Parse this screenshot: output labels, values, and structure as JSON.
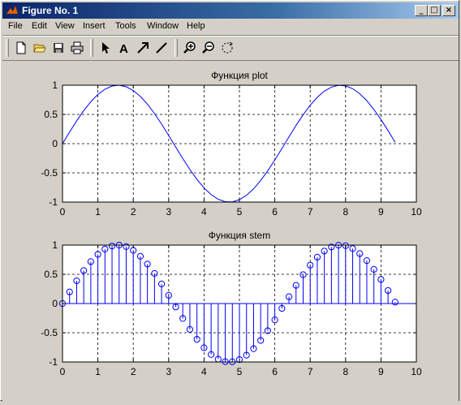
{
  "window": {
    "title": "Figure No. 1"
  },
  "window_buttons": {
    "minimize": "_",
    "maximize": "□",
    "close": "×"
  },
  "menu": [
    "File",
    "Edit",
    "View",
    "Insert",
    "Tools",
    "Window",
    "Help"
  ],
  "toolbar": {
    "icons": [
      "new-file-icon",
      "open-folder-icon",
      "save-icon",
      "print-icon",
      "pointer-arrow-icon",
      "insert-text-icon",
      "insert-arrow-icon",
      "insert-line-icon",
      "zoom-in-icon",
      "zoom-out-icon",
      "rotate-icon"
    ],
    "text_tool_glyph": "A"
  },
  "colors": {
    "line": "#0000ff",
    "background": "#d4d0c8",
    "axes_bg": "#ffffff"
  },
  "chart_data": [
    {
      "type": "line",
      "title": "Функция plot",
      "function": "sin(x)",
      "x_start": 0,
      "x_end": 9.4,
      "x_step": 0.2,
      "xlim": [
        0,
        10
      ],
      "ylim": [
        -1,
        1
      ],
      "xticks": [
        "0",
        "1",
        "2",
        "3",
        "4",
        "5",
        "6",
        "7",
        "8",
        "9",
        "10"
      ],
      "yticks": [
        "1",
        "0.5",
        "0",
        "-0.5",
        "-1"
      ],
      "grid": true
    },
    {
      "type": "stem",
      "title": "Функция stem",
      "function": "sin(x)",
      "x_start": 0,
      "x_end": 9.4,
      "x_step": 0.2,
      "xlim": [
        0,
        10
      ],
      "ylim": [
        -1,
        1
      ],
      "xticks": [
        "0",
        "1",
        "2",
        "3",
        "4",
        "5",
        "6",
        "7",
        "8",
        "9",
        "10"
      ],
      "yticks": [
        "1",
        "0.5",
        "0",
        "-0.5",
        "-1"
      ],
      "grid": true
    }
  ]
}
